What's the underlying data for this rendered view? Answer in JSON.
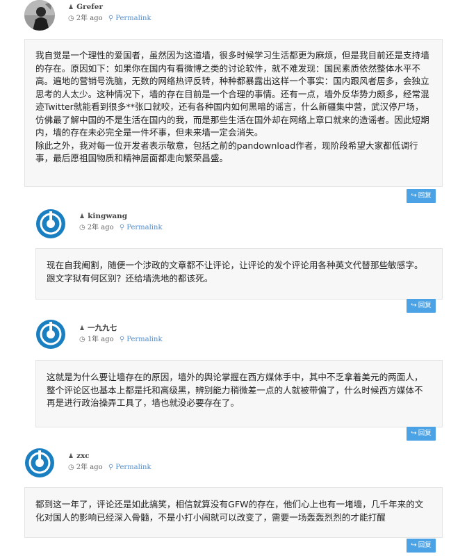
{
  "comments": [
    {
      "author": "Grefer",
      "time": "2年 ago",
      "permalink": "Permalink",
      "avatar_type": "photo",
      "body": [
        "我自觉是一个理性的爱国者，虽然因为这道墙，很多时候学习生活都更为麻烦，但是我目前还是支持墙的存在。原因如下：如果你在国内有看微博之类的讨论软件，就不难发现：国民素质依然整体水平不高。遍地的营销号洗脑，无数的网络热评反转，种种都暴露出这样一个事实：国内跟风者居多，会独立思考的人太少。这种情况下，墙的存在目前是一个合理的事情。还有一点，墙外反华势力颇多，经常混迹Twitter就能看到很多**张口就咬，还有各种国内如何黑暗的谣言，什么新疆集中营，武汉停尸场，仿佛最了解中国的不是生活在国内的我，而是那些生活在国外却在网络上章口就来的造谣者。因此短期内，墙的存在未必完全是一件坏事，但未来墙一定会消失。",
        "除此之外，我对每一位开发者表示敬意，包括之前的pandownload作者，现阶段希望大家都低调行事，最后愿祖国物质和精神层面都走向繁荣昌盛。"
      ],
      "reply": "回复"
    },
    {
      "author": "kingwang",
      "time": "2年 ago",
      "permalink": "Permalink",
      "avatar_type": "wp-logo",
      "body": [
        "现在自我阉割，随便一个涉政的文章都不让评论，让评论的发个评论用各种英文代替那些敏感字。跟文字狱有何区别？还给墙洗地的都该死。"
      ],
      "reply": "回复"
    },
    {
      "author": "一九九七",
      "time": "1年 ago",
      "permalink": "Permalink",
      "avatar_type": "wp-logo",
      "body": [
        "这就是为什么要让墙存在的原因，墙外的舆论掌握在西方媒体手中，其中不乏拿着美元的两面人，整个评论区也基本上都是托和高级黑，辨别能力稍微差一点的人就被带偏了，什么时候西方媒体不再是进行政治操弄工具了，墙也就没必要存在了。"
      ],
      "reply": "回复"
    },
    {
      "author": "zxc",
      "time": "2年 ago",
      "permalink": "Permalink",
      "avatar_type": "wp-logo",
      "body": [
        "都到这一年了，评论还是如此搞笑，相信就算没有GFW的存在，他们心上也有一堵墙，几千年来的文化对国人的影响已经深入骨髓，不是小打小闹就可以改变了，需要一场轰轰烈烈的才能打醒"
      ],
      "reply": "回复"
    }
  ],
  "colors": {
    "accent": "#4ba3e6",
    "link": "#4f8ed1",
    "box_bg": "#f7f7f7",
    "wp_logo": "#1a7fc1"
  }
}
